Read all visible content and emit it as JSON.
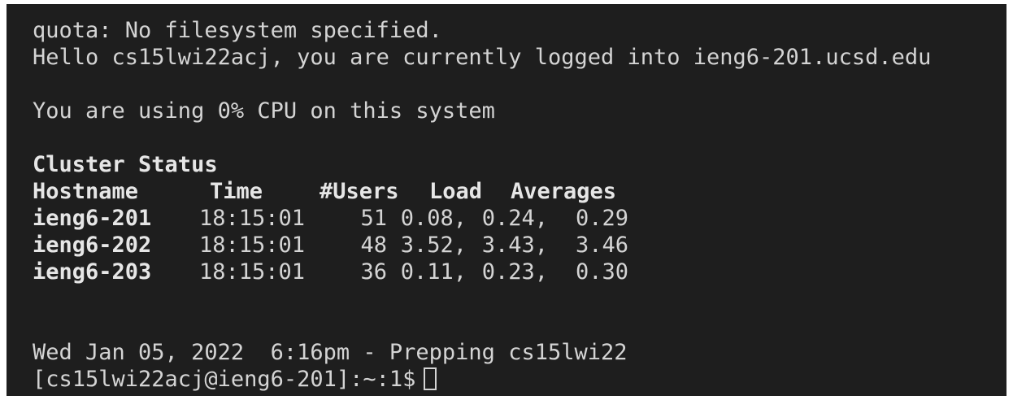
{
  "terminal": {
    "quota_line": "quota: No filesystem specified.",
    "hello_line": "Hello cs15lwi22acj, you are currently logged into ieng6-201.ucsd.edu",
    "cpu_line": "You are using 0% CPU on this system",
    "cluster_title": "Cluster Status",
    "headers": {
      "hostname": "Hostname",
      "time": "Time",
      "users": "#Users",
      "load": "Load",
      "averages": "Averages"
    },
    "rows": [
      {
        "host": "ieng6-201",
        "time": "18:15:01",
        "users": "51",
        "l1": "0.08,",
        "l2": "0.24,",
        "l3": "0.29"
      },
      {
        "host": "ieng6-202",
        "time": "18:15:01",
        "users": "48",
        "l1": "3.52,",
        "l2": "3.43,",
        "l3": "3.46"
      },
      {
        "host": "ieng6-203",
        "time": "18:15:01",
        "users": "36",
        "l1": "0.11,",
        "l2": "0.23,",
        "l3": "0.30"
      }
    ],
    "date_line": "Wed Jan 05, 2022  6:16pm - Prepping cs15lwi22",
    "prompt": "[cs15lwi22acj@ieng6-201]:~:1$"
  }
}
